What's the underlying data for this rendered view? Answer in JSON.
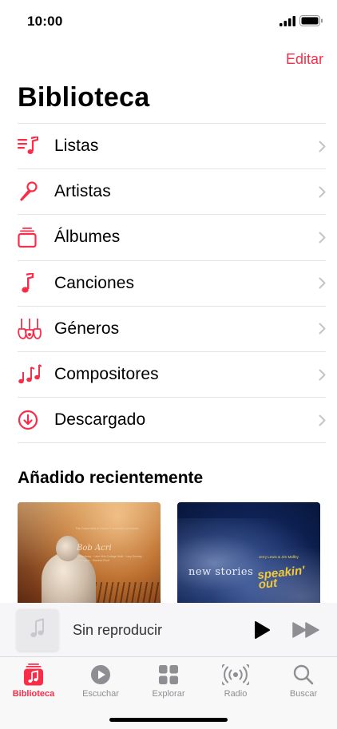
{
  "status_bar": {
    "time": "10:00"
  },
  "colors": {
    "accent": "#fa2d48",
    "separator": "#e3e3e6",
    "inactive_tab": "#8e8e93"
  },
  "header": {
    "edit_label": "Editar",
    "title": "Biblioteca"
  },
  "library_items": [
    {
      "label": "Listas",
      "icon": "playlist-icon"
    },
    {
      "label": "Artistas",
      "icon": "microphone-icon"
    },
    {
      "label": "Álbumes",
      "icon": "album-stack-icon"
    },
    {
      "label": "Canciones",
      "icon": "music-note-icon"
    },
    {
      "label": "Géneros",
      "icon": "guitars-icon"
    },
    {
      "label": "Compositores",
      "icon": "notes-icon"
    },
    {
      "label": "Descargado",
      "icon": "download-circle-icon"
    }
  ],
  "recently_added": {
    "title": "Añadido recientemente",
    "albums": [
      {
        "art_title": "Bob Acri",
        "art_small_text_top": "The Coachella of Music Foundation presents",
        "art_small_text_bottom": "Sleep Away · Lake Hills Cottage Walk · Lazy Sunday · 60 Fingers · Stacked Roof"
      },
      {
        "art_title_1": "new stories",
        "art_title_2": "speakin' out",
        "art_small_text": "Jerry Lewis & Jim Maffey"
      }
    ]
  },
  "mini_player": {
    "title": "Sin reproducir"
  },
  "tab_bar": {
    "tabs": [
      {
        "label": "Biblioteca",
        "icon": "library-icon",
        "active": true
      },
      {
        "label": "Escuchar",
        "icon": "play-circle-icon",
        "active": false
      },
      {
        "label": "Explorar",
        "icon": "grid-icon",
        "active": false
      },
      {
        "label": "Radio",
        "icon": "radio-waves-icon",
        "active": false
      },
      {
        "label": "Buscar",
        "icon": "search-icon",
        "active": false
      }
    ]
  }
}
